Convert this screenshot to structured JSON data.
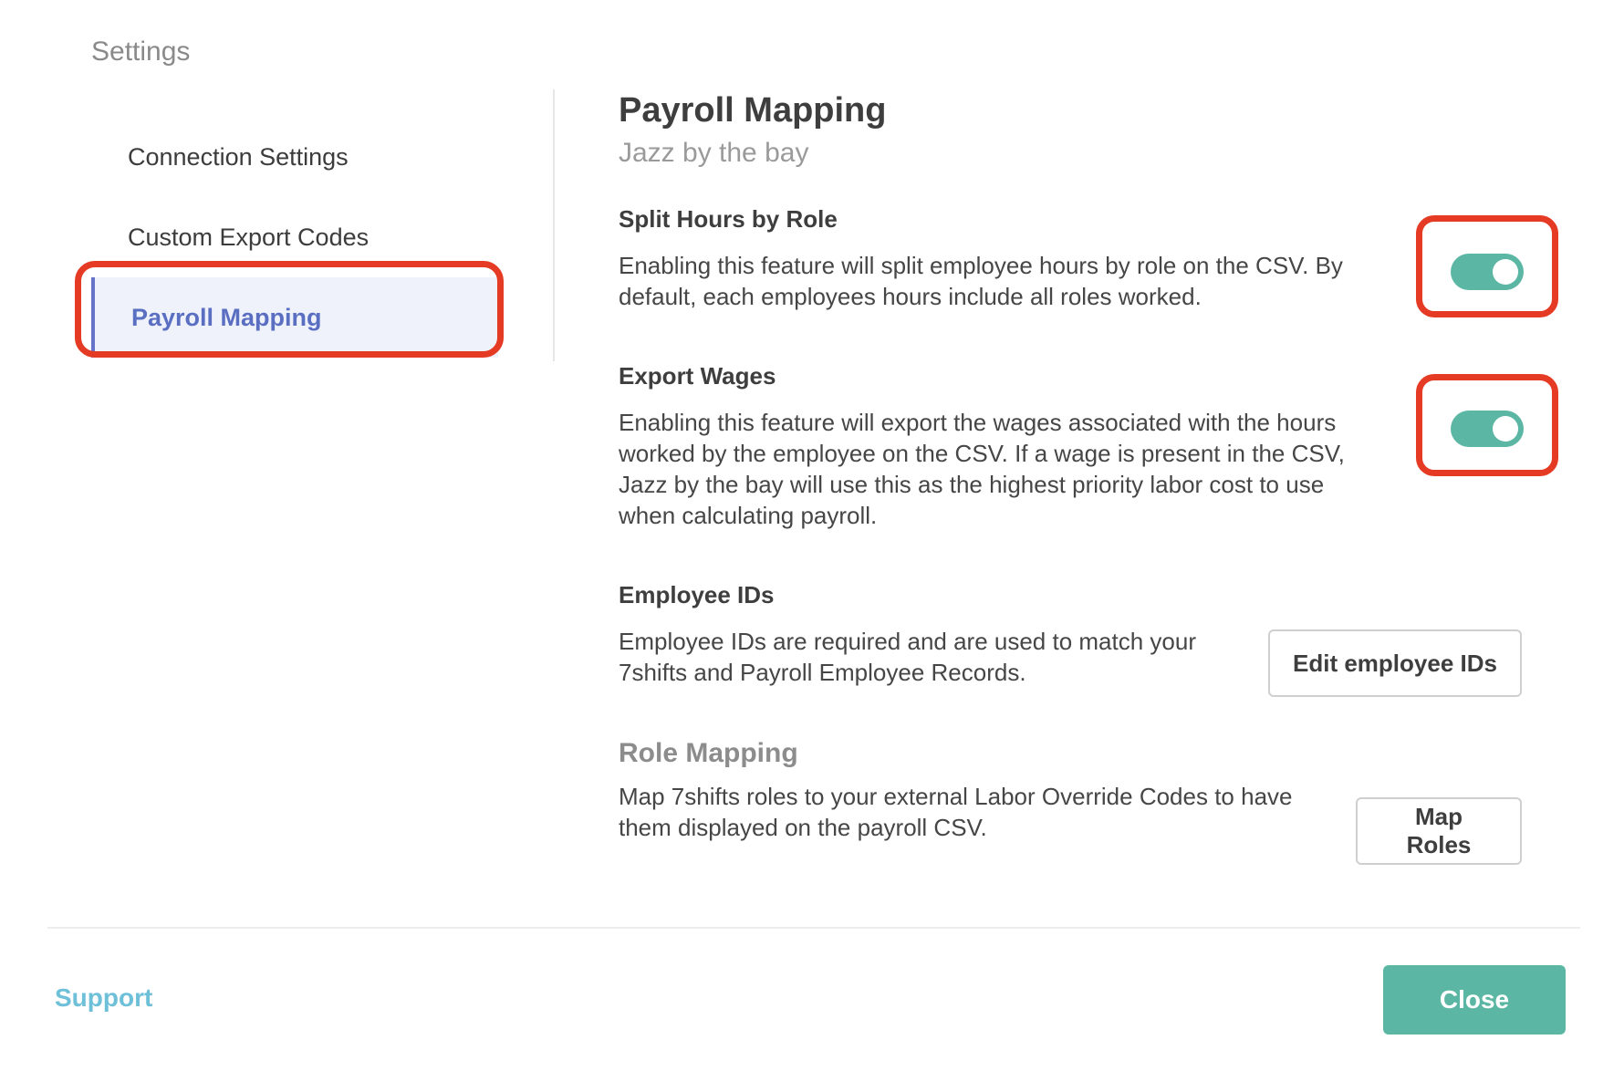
{
  "header": {
    "title": "Settings"
  },
  "sidebar": {
    "items": [
      {
        "label": "Connection Settings",
        "active": false
      },
      {
        "label": "Custom Export Codes",
        "active": false
      },
      {
        "label": "Payroll Mapping",
        "active": true
      }
    ]
  },
  "main": {
    "title": "Payroll Mapping",
    "subtitle": "Jazz by the bay",
    "sections": {
      "split_hours": {
        "title": "Split Hours by Role",
        "description": "Enabling this feature will split employee hours by role on the CSV. By default, each employees hours include all roles worked.",
        "toggle_on": true
      },
      "export_wages": {
        "title": "Export Wages",
        "description": "Enabling this feature will export the wages associated with the hours worked by the employee on the CSV. If a wage is present in the CSV, Jazz by the bay will use this as the highest priority labor cost to use when calculating payroll.",
        "toggle_on": true
      },
      "employee_ids": {
        "title": "Employee IDs",
        "description": "Employee IDs are required and are used to match your 7shifts and Payroll Employee Records.",
        "button_label": "Edit employee IDs"
      },
      "role_mapping": {
        "title": "Role Mapping",
        "description": "Map 7shifts roles to your external Labor Override Codes to have them displayed on the payroll CSV.",
        "button_label": "Map Roles"
      }
    }
  },
  "footer": {
    "support_label": "Support",
    "close_label": "Close"
  },
  "colors": {
    "accent_teal": "#5bb7a3",
    "active_nav": "#5a6fc2",
    "highlight_red": "#e53a23",
    "support_link": "#6ec0d9"
  },
  "icons": {
    "toggle": "toggle-switch"
  }
}
